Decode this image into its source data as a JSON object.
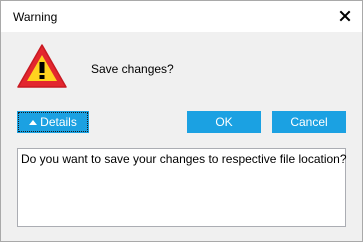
{
  "window": {
    "title": "Warning",
    "close_icon": "close-icon"
  },
  "dialog": {
    "icon": "warning-icon",
    "message": "Save changes?",
    "details_text": "Do you want to save your changes to respective file location?"
  },
  "buttons": {
    "details_label": "Details",
    "details_icon": "chevron-up-icon",
    "ok_label": "OK",
    "cancel_label": "Cancel"
  },
  "colors": {
    "button_bg": "#1ba1e2",
    "button_text": "#ffffff",
    "warning_red": "#e3262e",
    "warning_yellow": "#ffd21f"
  }
}
